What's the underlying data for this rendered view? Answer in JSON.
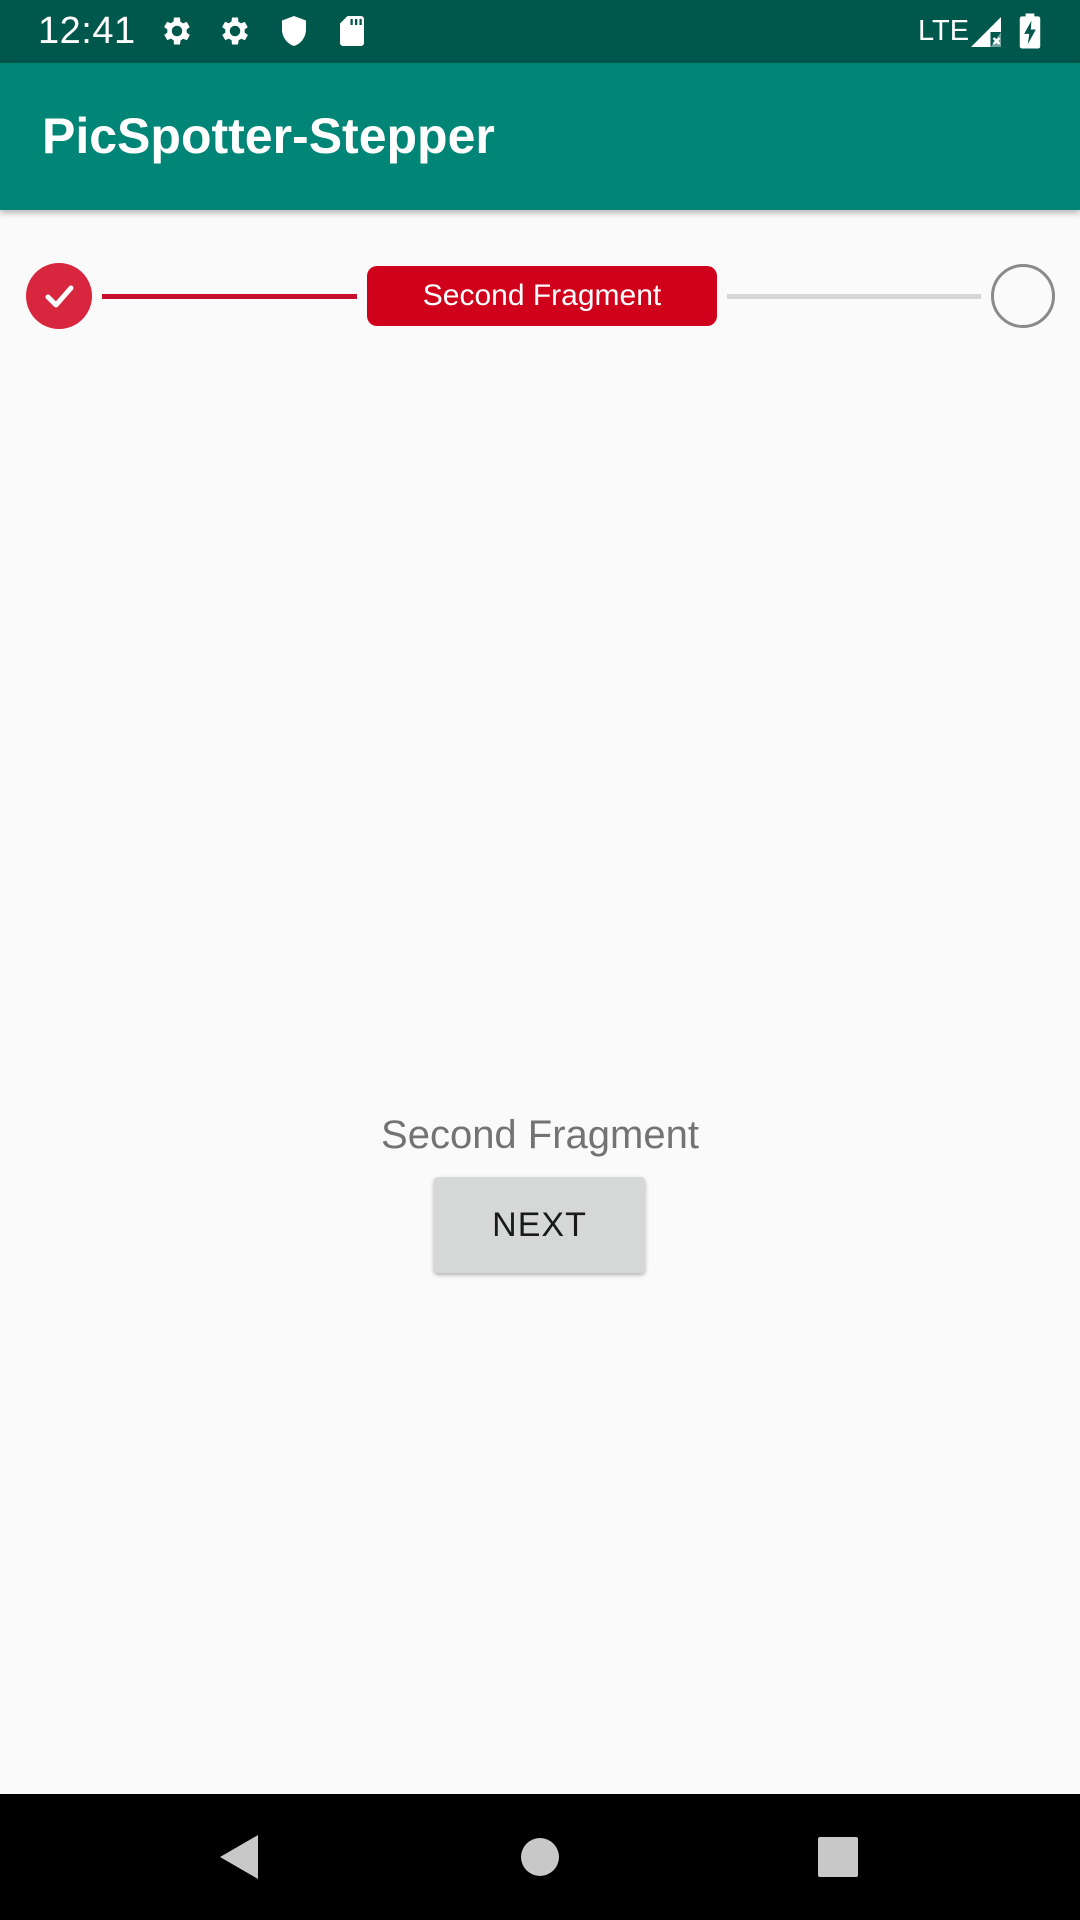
{
  "status_bar": {
    "time": "12:41",
    "icons": [
      "gear-icon",
      "gear-icon",
      "shield-icon",
      "sd-card-icon"
    ],
    "network": "LTE",
    "signal_icon": "signal-icon",
    "battery_icon": "battery-charging-icon",
    "background_color": "#00574b"
  },
  "app_bar": {
    "title": "PicSpotter-Stepper",
    "background_color": "#008577"
  },
  "stepper": {
    "steps": [
      {
        "state": "completed",
        "icon": "check-icon"
      },
      {
        "state": "current",
        "label": "Second Fragment"
      },
      {
        "state": "pending"
      }
    ],
    "active_color": "#d0021b",
    "inactive_color": "#d6d6d6"
  },
  "content": {
    "fragment_text": "Second Fragment",
    "next_button_label": "NEXT"
  },
  "nav_bar": {
    "buttons": [
      "back-icon",
      "home-icon",
      "recents-icon"
    ]
  }
}
